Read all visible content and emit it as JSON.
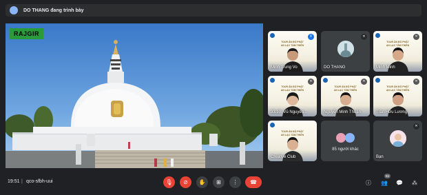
{
  "presenter_bar": {
    "text": "DO THANG đang trình bày"
  },
  "stage": {
    "place_label": "RAJGIR"
  },
  "tiles": [
    {
      "name": "Minh Trung Vo"
    },
    {
      "name": "DO THANG"
    },
    {
      "name": "Minh Minh"
    },
    {
      "name": "33.10. Vũ Nguyên..."
    },
    {
      "name": "Nguyễn Minh Thuận"
    },
    {
      "name": "Trần Hữu Lương"
    },
    {
      "name": "Creative Club"
    },
    {
      "name": "85 người khác"
    },
    {
      "name": "Bạn"
    }
  ],
  "poster": {
    "line1": "TOUR ẢN ĐỘ PHẬT",
    "line2": "AN LẠC TÂM THIỀN"
  },
  "bottom_bar": {
    "time": "19:51",
    "separator": "|",
    "meeting_code": "qco-sfbh-uui",
    "participants_badge": "94"
  },
  "icons": {
    "mic_off": "mic-off-icon",
    "cam_off": "camera-off-icon",
    "hand": "raise-hand-icon",
    "present": "present-icon",
    "more": "more-options-icon",
    "end": "end-call-icon",
    "info": "info-icon",
    "people": "people-icon",
    "chat": "chat-icon",
    "activities": "activities-icon"
  },
  "colors": {
    "end_red": "#ea4335",
    "active_blue": "#1a73e8",
    "label_green": "#2a9b3a"
  }
}
